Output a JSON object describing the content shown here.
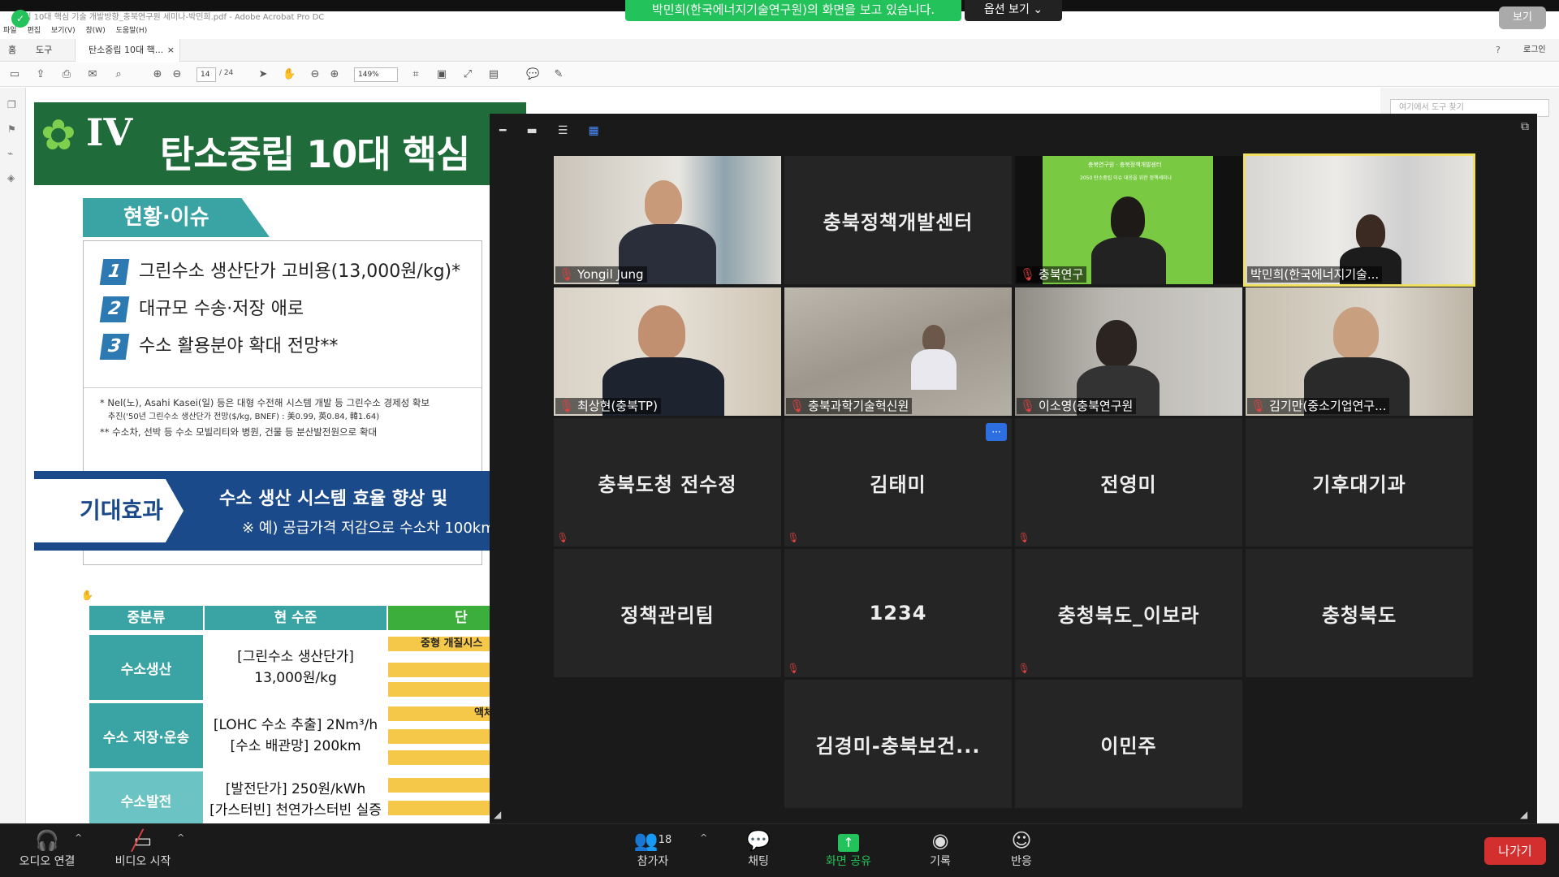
{
  "acrobat": {
    "window_title": "중립 10대 핵심 기술 개발방향_충북연구원 세미나-박민희.pdf - Adobe Acrobat Pro DC",
    "menu": [
      "파일",
      "편집",
      "보기(V)",
      "창(W)",
      "도움말(H)"
    ],
    "tabs": {
      "home": "홈",
      "tools": "도구",
      "doc": "탄소중립 10대 핵..."
    },
    "login": "로그인",
    "page_current": "14",
    "page_total": "/ 24",
    "zoom_level": "149%",
    "find_tool_placeholder": "여기에서 도구 찾기"
  },
  "slide": {
    "section_num": "IV",
    "title": "탄소중립 10대 핵심",
    "issue_tab": "현황·이슈",
    "issues": [
      {
        "num": "1",
        "text": "그린수소 생산단가 고비용(13,000원/kg)*"
      },
      {
        "num": "2",
        "text": "대규모 수송·저장 애로"
      },
      {
        "num": "3",
        "text": "수소 활용분야 확대 전망**"
      }
    ],
    "note1": "* Nel(노), Asahi Kasei(일) 등은 대형 수전해 시스템 개발 등 그린수소 경제성 확보",
    "note1b": "추진('50년 그린수소 생산단가 전망($/kg, BNEF) : 美0.99, 英0.84, 韓1.64)",
    "note2": "** 수소차, 선박 등 수소 모빌리티와 병원, 건물 등 분산발전원으로 확대",
    "effect_label": "기대효과",
    "effect_text1": "수소 생산 시스템 효율 향상 및",
    "effect_text2": "※ 예) 공급가격 저감으로 수소차 100km",
    "table": {
      "headers": [
        "중분류",
        "현 수준",
        "단"
      ],
      "rows": [
        {
          "label": "수소생산",
          "cell": [
            "[그린수소 생산단가]",
            "13,000원/kg"
          ],
          "bar": "중형 개질시스"
        },
        {
          "label": "수소 저장·운송",
          "cell": [
            "[LOHC 수소 추출] 2Nm³/h",
            "[수소 배관망] 200km"
          ],
          "bar": "액체"
        },
        {
          "label": "수소발전",
          "cell": [
            "[발전단가] 250원/kWh",
            "[가스터빈] 천연가스터빈 실증"
          ],
          "bar": ""
        }
      ]
    }
  },
  "zoom": {
    "banner": "박민희(한국에너지기술연구원)의 화면을 보고 있습니다.",
    "options": "옵션 보기",
    "view_button": "보기",
    "participants": [
      {
        "name": "Yongil Jung",
        "type": "video",
        "muted": true
      },
      {
        "name": "충북정책개발센터",
        "type": "name",
        "muted": false
      },
      {
        "name": "충북연구",
        "type": "video",
        "muted": true
      },
      {
        "name": "박민희(한국에너지기술...",
        "type": "video",
        "muted": false,
        "active": true
      },
      {
        "name": "최상현(충북TP)",
        "type": "video",
        "muted": true
      },
      {
        "name": "충북과학기술혁신원",
        "type": "video",
        "muted": true
      },
      {
        "name": "이소영(충북연구원",
        "type": "video",
        "muted": true
      },
      {
        "name": "김기만(중소기업연구...",
        "type": "video",
        "muted": true
      },
      {
        "name": "충북도청 전수정",
        "type": "name",
        "muted": true
      },
      {
        "name": "김태미",
        "type": "name",
        "muted": true
      },
      {
        "name": "전영미",
        "type": "name",
        "muted": true
      },
      {
        "name": "기후대기과",
        "type": "name",
        "muted": false
      },
      {
        "name": "정책관리팀",
        "type": "name",
        "muted": false
      },
      {
        "name": "1234",
        "type": "name",
        "muted": true
      },
      {
        "name": "충청북도_이보라",
        "type": "name",
        "muted": true
      },
      {
        "name": "충청북도",
        "type": "name",
        "muted": false
      },
      {
        "name": "김경미-충북보건...",
        "type": "name",
        "muted": false
      },
      {
        "name": "이민주",
        "type": "name",
        "muted": false
      }
    ],
    "video_slide_text": "충북연구원 · 충북정책개발센터",
    "video_slide_sub": "2050 탄소중립 이슈 대응을 위한 정책세미나",
    "more": "···"
  },
  "toolbar": {
    "audio": "오디오 연결",
    "video": "비디오 시작",
    "participants": "참가자",
    "participants_count": "18",
    "chat": "채팅",
    "share": "화면 공유",
    "record": "기록",
    "react": "반응",
    "leave": "나가기"
  },
  "colors": {
    "share_green": "#23c25a",
    "leave_red": "#d32f2f",
    "active_speaker": "#f0e060",
    "slide_green": "#1f6b3a",
    "slide_teal": "#3aa3a3",
    "slide_blue": "#1b4a8a"
  }
}
